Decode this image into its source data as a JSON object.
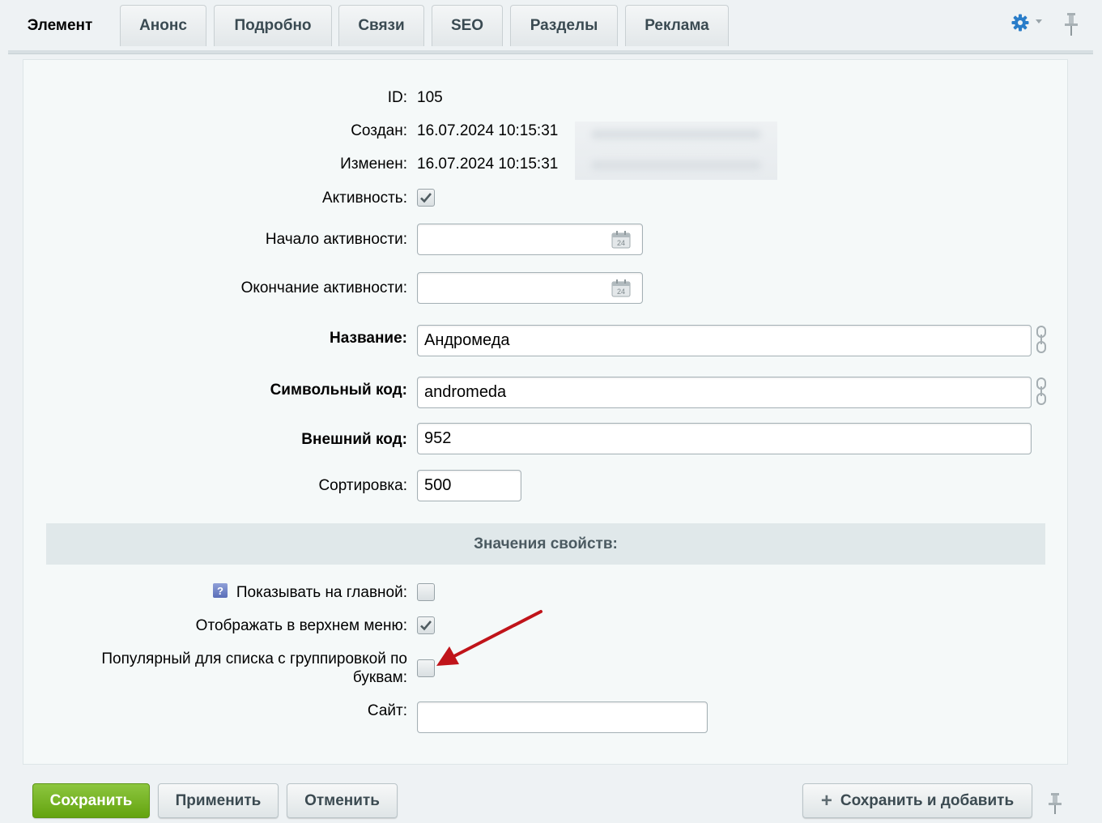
{
  "tabs": [
    "Элемент",
    "Анонс",
    "Подробно",
    "Связи",
    "SEO",
    "Разделы",
    "Реклама"
  ],
  "fields": {
    "id_label": "ID:",
    "id_value": "105",
    "created_label": "Создан:",
    "created_value": "16.07.2024 10:15:31",
    "modified_label": "Изменен:",
    "modified_value": "16.07.2024 10:15:31",
    "active_label": "Активность:",
    "active_checked": true,
    "active_from_label": "Начало активности:",
    "active_from_value": "",
    "active_to_label": "Окончание активности:",
    "active_to_value": "",
    "name_label": "Название:",
    "name_value": "Андромеда",
    "code_label": "Символьный код:",
    "code_value": "andromeda",
    "xml_id_label": "Внешний код:",
    "xml_id_value": "952",
    "sort_label": "Сортировка:",
    "sort_value": "500"
  },
  "properties": {
    "title": "Значения свойств:",
    "help_glyph": "?",
    "show_main_label": "Показывать на главной:",
    "show_main_checked": false,
    "top_menu_label": "Отображать в верхнем меню:",
    "top_menu_checked": true,
    "popular_label_line1": "Популярный для списка с группировкой по",
    "popular_label_line2": "буквам:",
    "popular_checked": false,
    "site_label": "Сайт:",
    "site_value": ""
  },
  "buttons": {
    "save": "Сохранить",
    "apply": "Применить",
    "cancel": "Отменить",
    "save_add": "Сохранить и добавить",
    "save_add_glyph": "+"
  },
  "colors": {
    "save_button": "#72b21f",
    "accent_gear": "#2a7dc9",
    "annotation_arrow": "#c0141a"
  }
}
